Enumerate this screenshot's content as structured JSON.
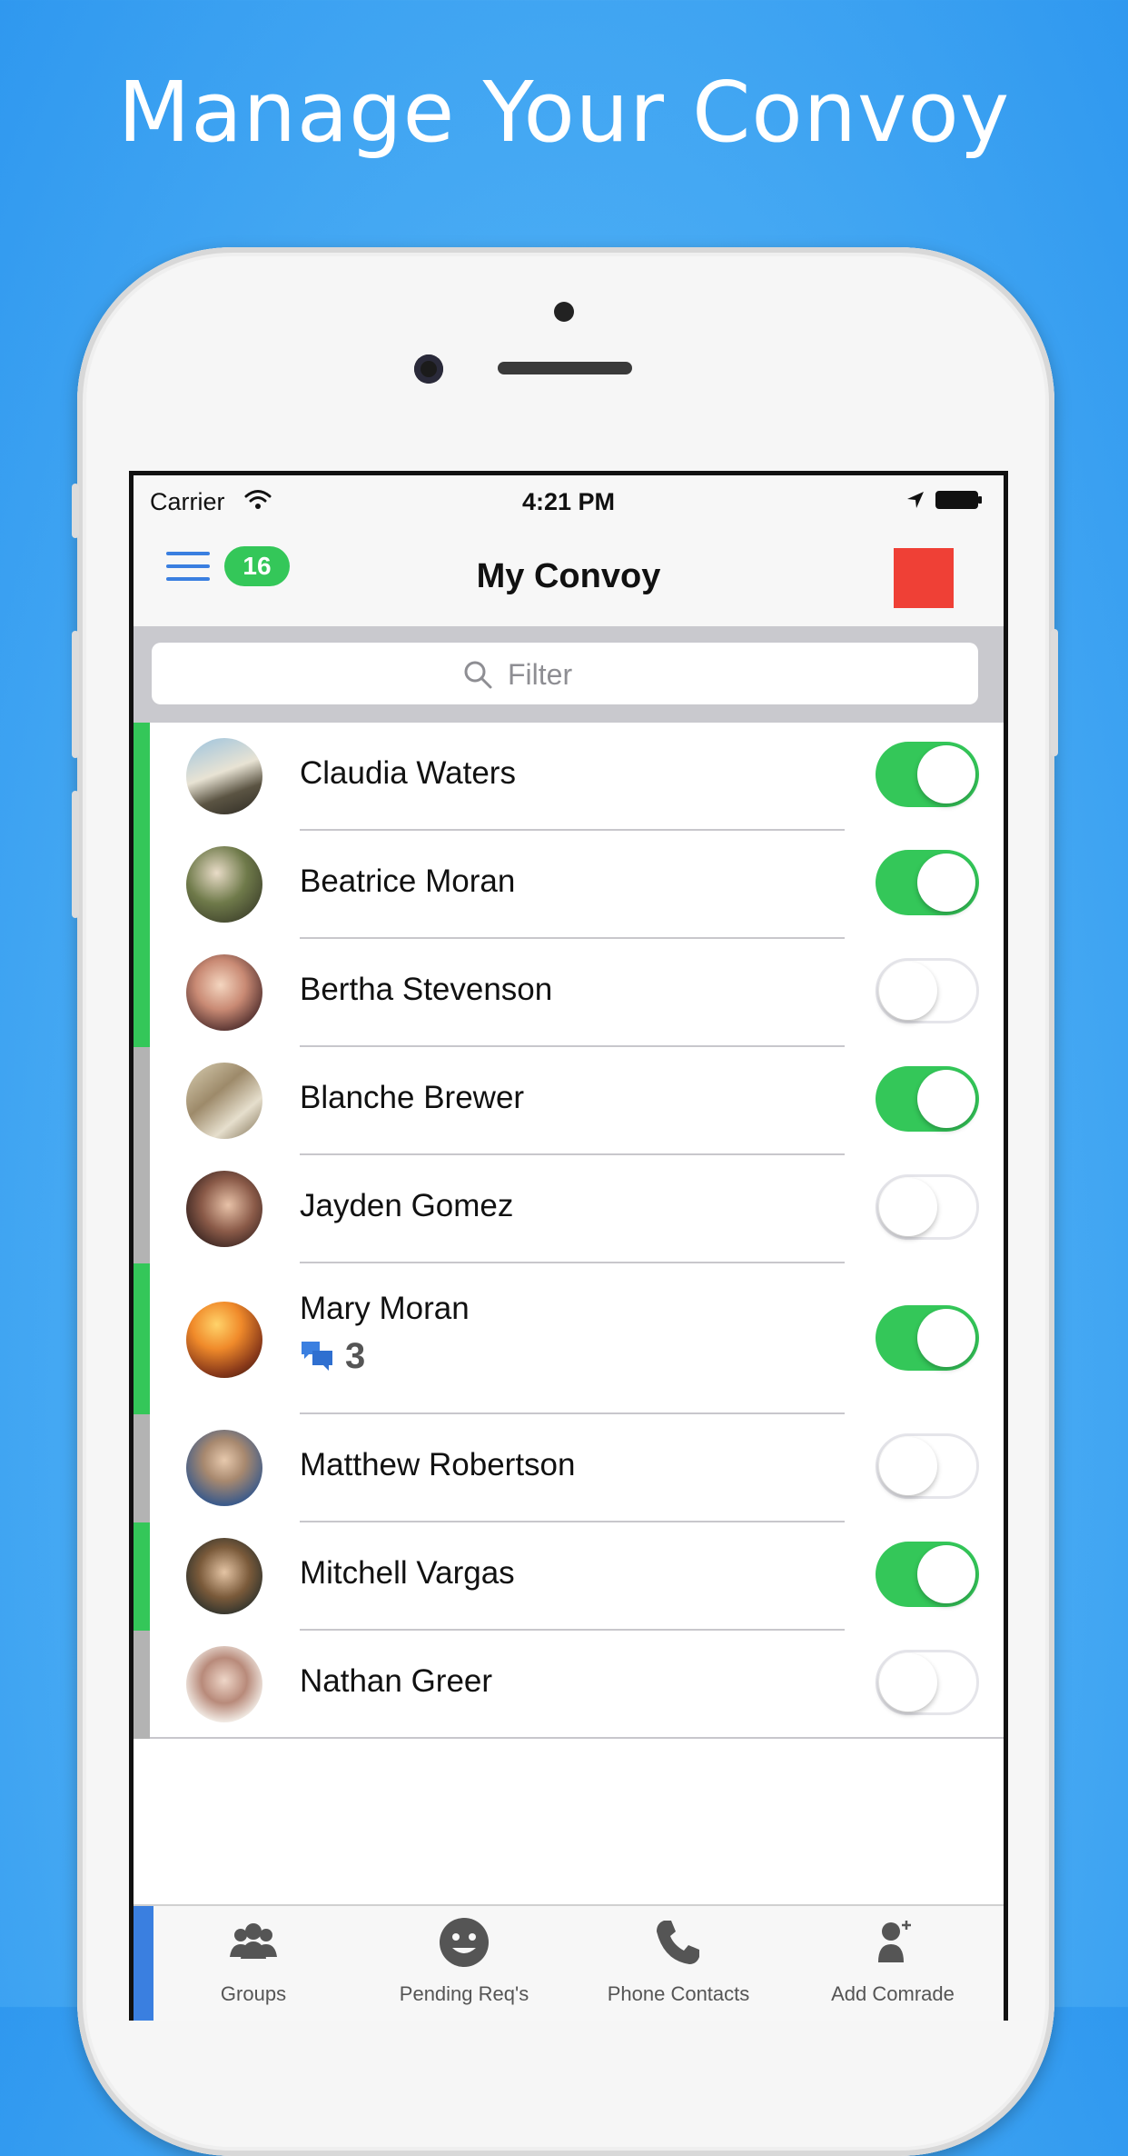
{
  "headline": "Manage Your Convoy",
  "status_bar": {
    "carrier": "Carrier",
    "time": "4:21 PM"
  },
  "nav": {
    "badge": "16",
    "title": "My Convoy"
  },
  "search": {
    "placeholder": "Filter"
  },
  "contacts": [
    {
      "name": "Claudia Waters",
      "enabled": true,
      "status": "active"
    },
    {
      "name": "Beatrice Moran",
      "enabled": true,
      "status": "active"
    },
    {
      "name": "Bertha Stevenson",
      "enabled": false,
      "status": "active"
    },
    {
      "name": "Blanche Brewer",
      "enabled": true,
      "status": "inactive"
    },
    {
      "name": "Jayden Gomez",
      "enabled": false,
      "status": "inactive"
    },
    {
      "name": "Mary Moran",
      "enabled": true,
      "status": "active",
      "unread_messages": "3"
    },
    {
      "name": "Matthew Robertson",
      "enabled": false,
      "status": "inactive"
    },
    {
      "name": "Mitchell Vargas",
      "enabled": true,
      "status": "active"
    },
    {
      "name": "Nathan Greer",
      "enabled": false,
      "status": "inactive"
    }
  ],
  "tabs": [
    {
      "label": "Groups",
      "icon": "groups-icon"
    },
    {
      "label": "Pending Req's",
      "icon": "smiley-icon"
    },
    {
      "label": "Phone Contacts",
      "icon": "phone-icon"
    },
    {
      "label": "Add Comrade",
      "icon": "add-person-icon"
    }
  ],
  "colors": {
    "active": "#34c759",
    "inactive": "#b3b3b3",
    "accent": "#3a7fe0",
    "record": "#ef4036"
  }
}
